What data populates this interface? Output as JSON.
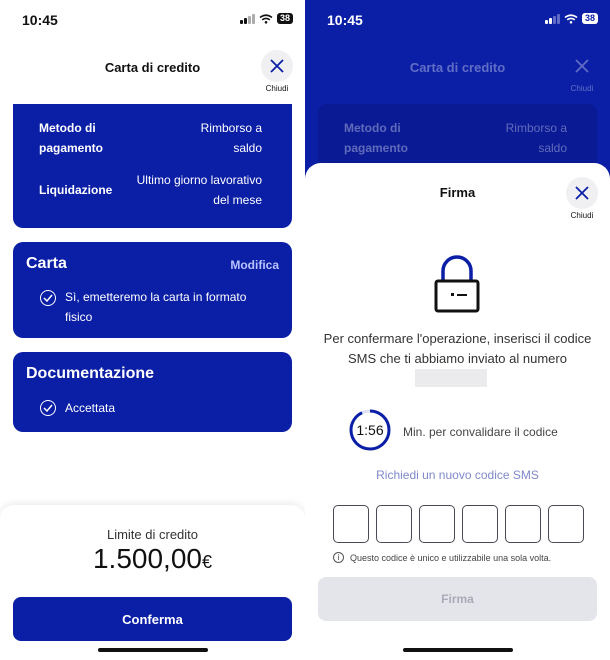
{
  "left": {
    "status": {
      "time": "10:45",
      "battery": "38"
    },
    "header": {
      "title": "Carta di credito",
      "close_label": "Chiudi"
    },
    "details": [
      {
        "key": "Metodo di pagamento",
        "value": "Rimborso a saldo"
      },
      {
        "key": "Liquidazione",
        "value": "Ultimo giorno lavorativo del mese"
      }
    ],
    "card_section": {
      "title": "Carta",
      "edit_label": "Modifica",
      "item": "Sì, emetteremo la carta in formato fisico"
    },
    "docs_section": {
      "title": "Documentazione",
      "item": "Accettata"
    },
    "limit": {
      "label": "Limite di credito",
      "value": "1.500,00",
      "currency": "€"
    },
    "confirm_label": "Conferma"
  },
  "right": {
    "status": {
      "time": "10:45",
      "battery": "38"
    },
    "bg_header": {
      "title": "Carta di credito",
      "close_label": "Chiudi"
    },
    "bg_details": [
      {
        "key": "Metodo di pagamento",
        "value": "Rimborso a saldo"
      }
    ],
    "modal": {
      "title": "Firma",
      "close_label": "Chiudi",
      "message": "Per confermare l'operazione, inserisci il codice SMS che ti abbiamo inviato al numero",
      "timer": "1:56",
      "timer_label": "Min. per convalidare il codice",
      "resend_label": "Richiedi un nuovo codice SMS",
      "info": "Questo codice è unico e utilizzabile una sola volta.",
      "submit_label": "Firma"
    }
  },
  "colors": {
    "brand": "#0b1ea6",
    "link": "#b9c3ff",
    "disabled": "#e4e5ea"
  }
}
